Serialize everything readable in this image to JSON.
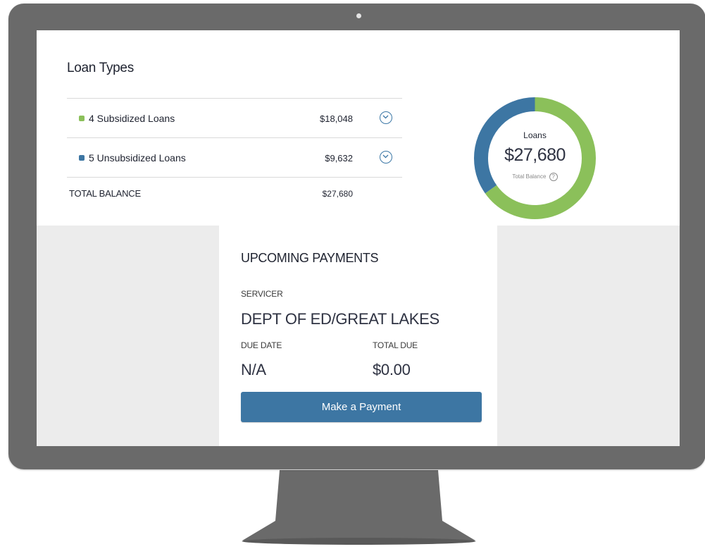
{
  "loan_types": {
    "title": "Loan Types",
    "rows": [
      {
        "label": "4 Subsidized Loans",
        "amount": "$18,048",
        "color": "#8bc05a",
        "icon": "chevron-down-icon"
      },
      {
        "label": "5 Unsubsidized Loans",
        "amount": "$9,632",
        "color": "#3d76a3",
        "icon": "chevron-down-icon"
      }
    ],
    "total_label": "TOTAL BALANCE",
    "total_amount": "$27,680"
  },
  "donut": {
    "title": "Loans",
    "value": "$27,680",
    "subtitle": "Total Balance",
    "help_icon": "?",
    "segments": [
      {
        "label": "4 Subsidized Loans",
        "value": 18048,
        "color": "#8bc05a"
      },
      {
        "label": "5 Unsubsidized Loans",
        "value": 9632,
        "color": "#3d76a3"
      }
    ]
  },
  "upcoming_payments": {
    "title": "UPCOMING PAYMENTS",
    "servicer_label": "SERVICER",
    "servicer_value": "DEPT OF ED/GREAT LAKES",
    "due_date_label": "DUE DATE",
    "due_date_value": "N/A",
    "total_due_label": "TOTAL DUE",
    "total_due_value": "$0.00",
    "button_label": "Make a Payment"
  }
}
